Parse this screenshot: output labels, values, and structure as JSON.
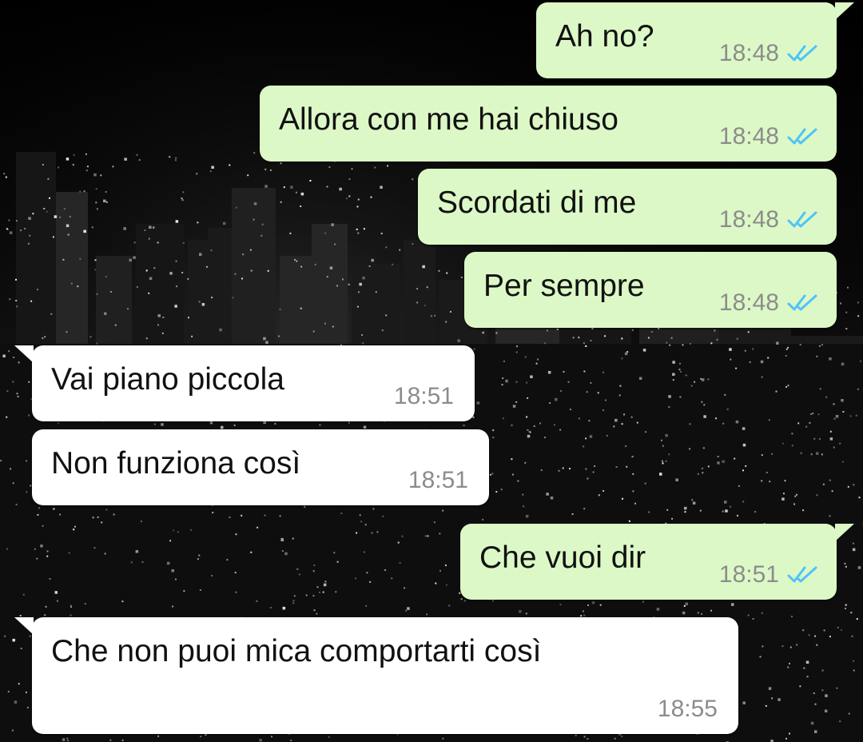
{
  "colors": {
    "outgoing_bubble": "#dcf8c6",
    "incoming_bubble": "#ffffff",
    "read_ticks": "#4fc3f7",
    "timestamp": "#8c8c8c",
    "wallpaper": "#050505"
  },
  "wallpaper": {
    "description_icon": "night-city-skyline-wallpaper"
  },
  "messages": [
    {
      "direction": "outgoing",
      "text": "Ah no?",
      "time": "18:48",
      "status_icon": "double-check-read-icon"
    },
    {
      "direction": "outgoing",
      "text": "Allora con me hai chiuso",
      "time": "18:48",
      "status_icon": "double-check-read-icon"
    },
    {
      "direction": "outgoing",
      "text": "Scordati di me",
      "time": "18:48",
      "status_icon": "double-check-read-icon"
    },
    {
      "direction": "outgoing",
      "text": "Per sempre",
      "time": "18:48",
      "status_icon": "double-check-read-icon"
    },
    {
      "direction": "incoming",
      "text": "Vai piano piccola",
      "time": "18:51"
    },
    {
      "direction": "incoming",
      "text": "Non funziona così",
      "time": "18:51"
    },
    {
      "direction": "outgoing",
      "text": "Che vuoi dir",
      "time": "18:51",
      "status_icon": "double-check-read-icon"
    },
    {
      "direction": "incoming",
      "text": "Che non puoi mica comportarti così",
      "time": "18:55"
    }
  ]
}
